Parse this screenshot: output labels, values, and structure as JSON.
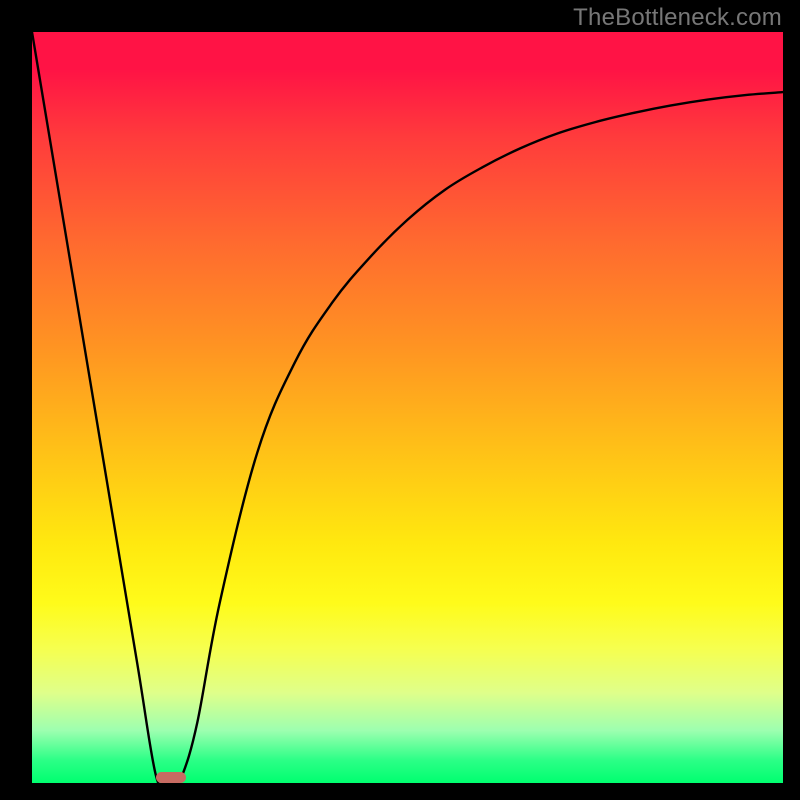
{
  "watermark_text": "TheBottleneck.com",
  "chart_data": {
    "type": "line",
    "title": "",
    "xlabel": "",
    "ylabel": "",
    "xlim": [
      0,
      100
    ],
    "ylim": [
      0,
      100
    ],
    "grid": false,
    "legend": false,
    "series": [
      {
        "name": "bottleneck-curve",
        "x": [
          0,
          5,
          10,
          14,
          16.5,
          18,
          19,
          20,
          22,
          25,
          30,
          35,
          40,
          45,
          50,
          55,
          60,
          65,
          70,
          75,
          80,
          85,
          90,
          95,
          100
        ],
        "y": [
          100,
          70,
          40,
          16,
          1,
          0,
          0,
          1,
          8,
          24,
          44,
          56,
          64,
          70,
          75,
          79,
          82,
          84.5,
          86.5,
          88,
          89.2,
          90.2,
          91,
          91.6,
          92
        ]
      }
    ],
    "marker": {
      "name": "optimal-range",
      "x_start": 16.5,
      "x_end": 20.5,
      "y": 0
    },
    "gradient_stops": [
      {
        "pos": 0,
        "color": "#ff1345"
      },
      {
        "pos": 28,
        "color": "#ff6a2f"
      },
      {
        "pos": 56,
        "color": "#ffc217"
      },
      {
        "pos": 76,
        "color": "#fffb1a"
      },
      {
        "pos": 93,
        "color": "#9dffb0"
      },
      {
        "pos": 100,
        "color": "#00ff70"
      }
    ]
  }
}
